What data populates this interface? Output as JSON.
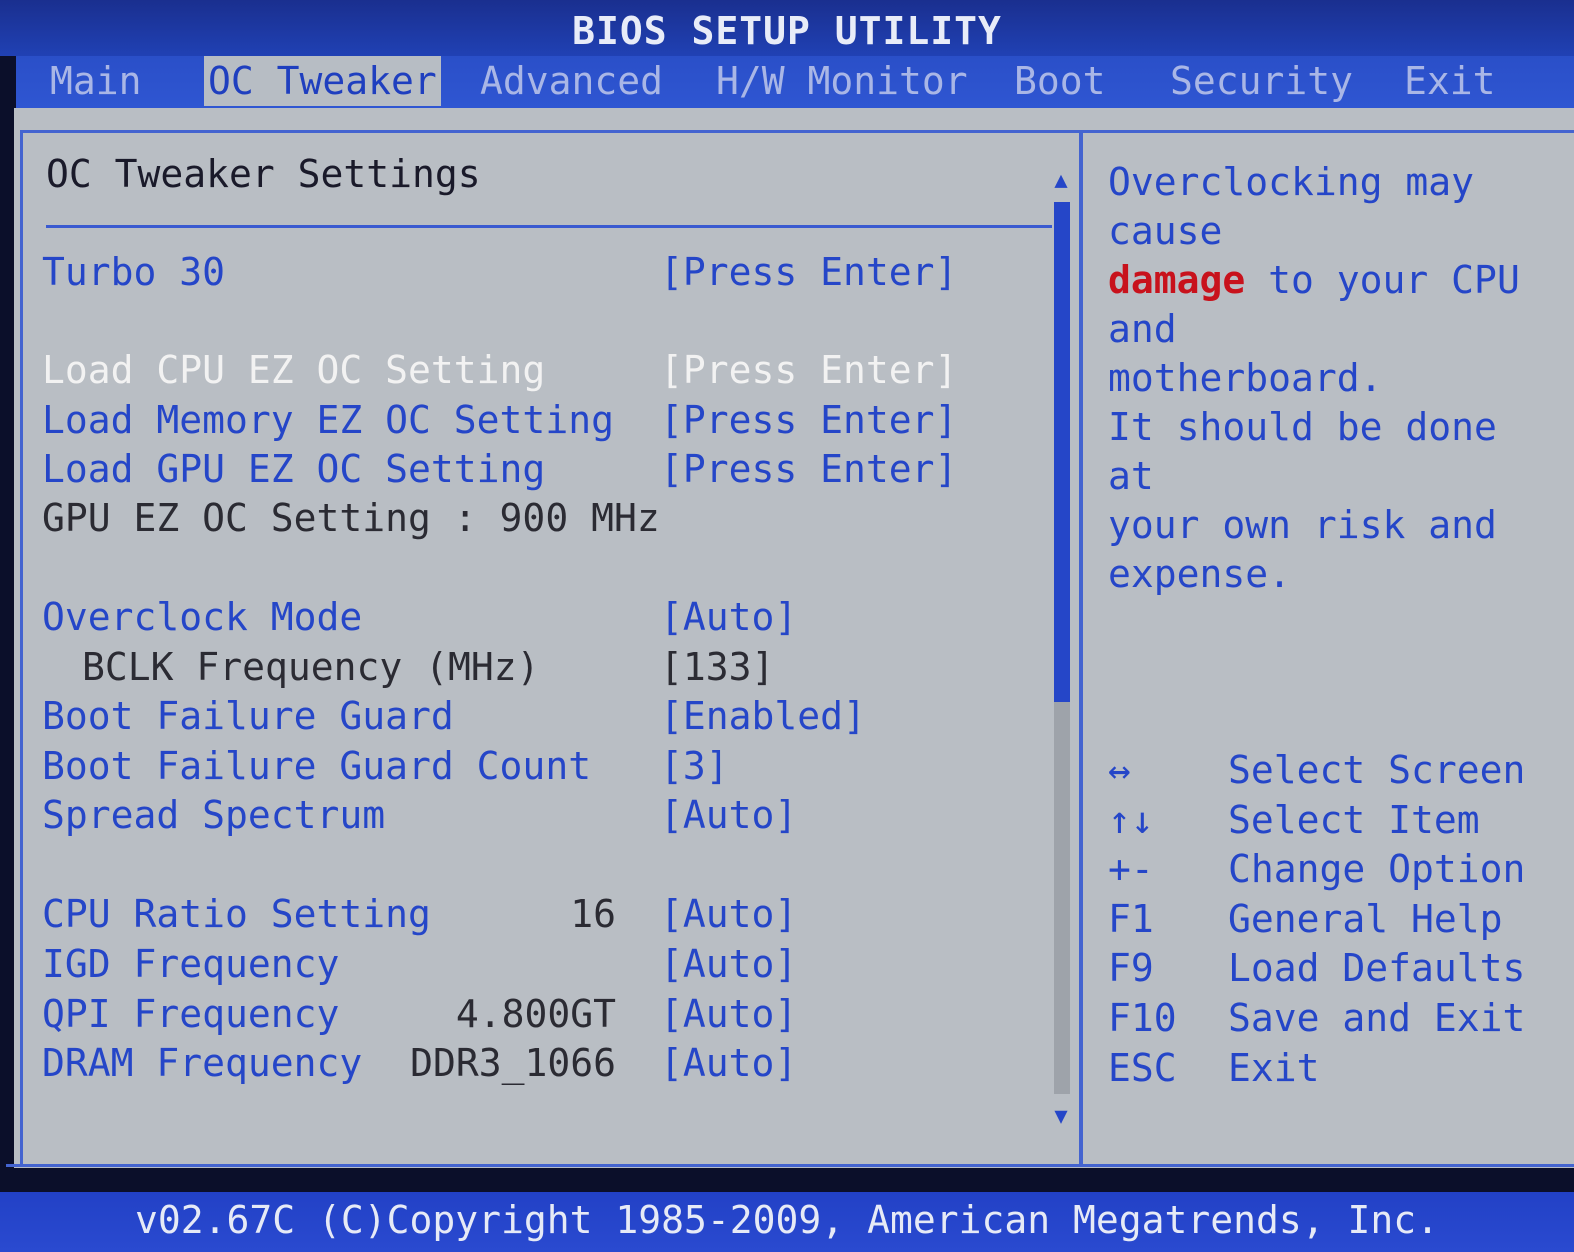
{
  "title": "BIOS SETUP UTILITY",
  "tabs": [
    {
      "label": "Main",
      "active": false
    },
    {
      "label": "OC Tweaker",
      "active": true
    },
    {
      "label": "Advanced",
      "active": false
    },
    {
      "label": "H/W Monitor",
      "active": false
    },
    {
      "label": "Boot",
      "active": false
    },
    {
      "label": "Security",
      "active": false
    },
    {
      "label": "Exit",
      "active": false
    }
  ],
  "section_title": "OC Tweaker Settings",
  "items": [
    {
      "label": "Turbo 30",
      "current": "",
      "value": "[Press Enter]",
      "style": "blue"
    },
    {
      "label": "Load CPU EZ OC Setting",
      "current": "",
      "value": "[Press Enter]",
      "style": "selected"
    },
    {
      "label": "Load Memory EZ OC Setting",
      "current": "",
      "value": "[Press Enter]",
      "style": "blue"
    },
    {
      "label": "Load GPU EZ OC Setting",
      "current": "",
      "value": "[Press Enter]",
      "style": "blue"
    },
    {
      "label": "GPU EZ OC Setting : 900 MHz",
      "current": "",
      "value": "",
      "style": "info"
    },
    {
      "label": "Overclock Mode",
      "current": "",
      "value": "[Auto]",
      "style": "blue"
    },
    {
      "label": "BCLK Frequency (MHz)",
      "current": "",
      "value": "[133]",
      "style": "sub"
    },
    {
      "label": "Boot Failure Guard",
      "current": "",
      "value": "[Enabled]",
      "style": "blue"
    },
    {
      "label": "Boot Failure Guard Count",
      "current": "",
      "value": "[3]",
      "style": "blue"
    },
    {
      "label": "Spread Spectrum",
      "current": "",
      "value": "[Auto]",
      "style": "blue"
    },
    {
      "label": "CPU Ratio Setting",
      "current": "16",
      "value": "[Auto]",
      "style": "blue"
    },
    {
      "label": "IGD Frequency",
      "current": "",
      "value": "[Auto]",
      "style": "blue"
    },
    {
      "label": "QPI Frequency",
      "current": "4.800GT",
      "value": "[Auto]",
      "style": "blue"
    },
    {
      "label": "DRAM Frequency",
      "current": "DDR3_1066",
      "value": "[Auto]",
      "style": "blue"
    }
  ],
  "scrollbar": {
    "position_fraction": 0.0,
    "visible_fraction": 0.56,
    "up_icon": "▲",
    "down_icon": "▼"
  },
  "help": {
    "line1": "Overclocking may cause",
    "warn_word": "damage",
    "line2_rest": " to your CPU and",
    "line3": "motherboard.",
    "line4": "It should be done at",
    "line5": "your own risk and",
    "line6": "expense."
  },
  "keys": [
    {
      "key": "↔",
      "desc": "Select Screen"
    },
    {
      "key": "↑↓",
      "desc": "Select Item"
    },
    {
      "key": "+-",
      "desc": "Change Option"
    },
    {
      "key": "F1",
      "desc": "General Help"
    },
    {
      "key": "F9",
      "desc": "Load Defaults"
    },
    {
      "key": "F10",
      "desc": "Save and Exit"
    },
    {
      "key": "ESC",
      "desc": "Exit"
    }
  ],
  "footer": "v02.67C (C)Copyright 1985-2009, American Megatrends, Inc.",
  "colors": {
    "accent_blue": "#2546c8",
    "warning_red": "#c8121c",
    "panel_gray": "#b9bec4"
  }
}
